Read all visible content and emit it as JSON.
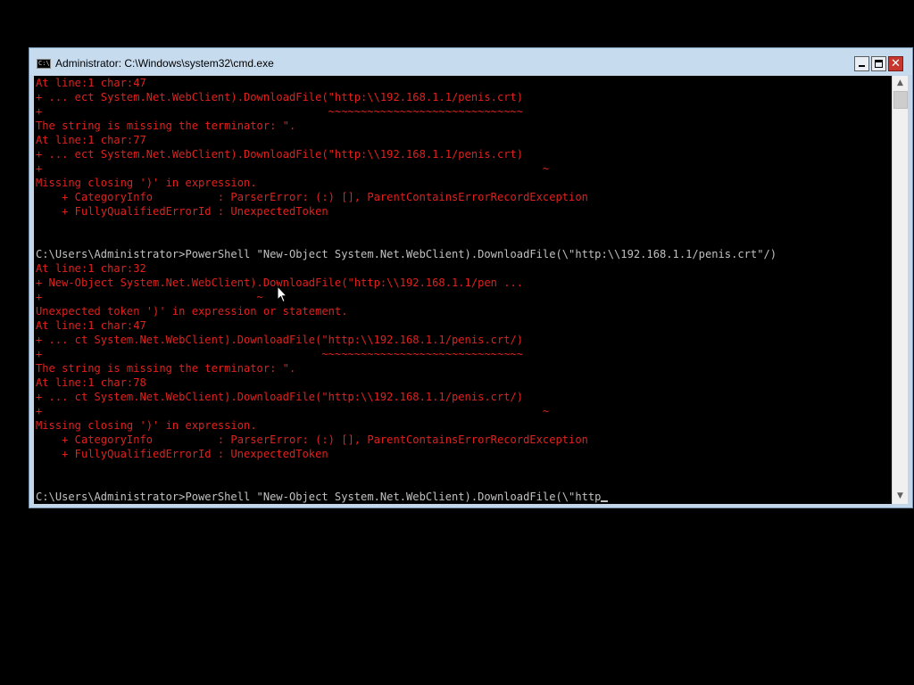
{
  "window": {
    "title": "Administrator: C:\\Windows\\system32\\cmd.exe",
    "icon": "console-icon",
    "icon_text": "C:\\",
    "controls": {
      "minimize": "minimize-icon",
      "maximize": "maximize-icon",
      "close": "✕"
    }
  },
  "colors": {
    "error_red": "#e0211d",
    "console_text": "#c0c0c0",
    "console_bg": "#000000"
  },
  "console": {
    "lines": [
      "At line:1 char:47",
      "+ ... ect System.Net.WebClient).DownloadFile(\"http:\\\\192.168.1.1/penis.crt)",
      "+                                            ~~~~~~~~~~~~~~~~~~~~~~~~~~~~~~",
      "The string is missing the terminator: \".",
      "At line:1 char:77",
      "+ ... ect System.Net.WebClient).DownloadFile(\"http:\\\\192.168.1.1/penis.crt)",
      "+                                                                             ~",
      "Missing closing ')' in expression.",
      "    + CategoryInfo          : ParserError: (:) [], ParentContainsErrorRecordException",
      "    + FullyQualifiedErrorId : UnexpectedToken",
      "",
      "",
      "C:\\Users\\Administrator>PowerShell \"New-Object System.Net.WebClient).DownloadFile(\\\"http:\\\\192.168.1.1/penis.crt\"/)",
      "At line:1 char:32",
      "+ New-Object System.Net.WebClient).DownloadFile(\"http:\\\\192.168.1.1/pen ...",
      "+                                 ~",
      "Unexpected token ')' in expression or statement.",
      "At line:1 char:47",
      "+ ... ct System.Net.WebClient).DownloadFile(\"http:\\\\192.168.1.1/penis.crt/)",
      "+                                           ~~~~~~~~~~~~~~~~~~~~~~~~~~~~~~~",
      "The string is missing the terminator: \".",
      "At line:1 char:78",
      "+ ... ct System.Net.WebClient).DownloadFile(\"http:\\\\192.168.1.1/penis.crt/)",
      "+                                                                             ~",
      "Missing closing ')' in expression.",
      "    + CategoryInfo          : ParserError: (:) [], ParentContainsErrorRecordException",
      "    + FullyQualifiedErrorId : UnexpectedToken",
      "",
      "",
      "C:\\Users\\Administrator>PowerShell \"New-Object System.Net.WebClient).DownloadFile(\\\"http"
    ]
  },
  "scrollbar": {
    "up_arrow": "▲",
    "down_arrow": "▼"
  }
}
